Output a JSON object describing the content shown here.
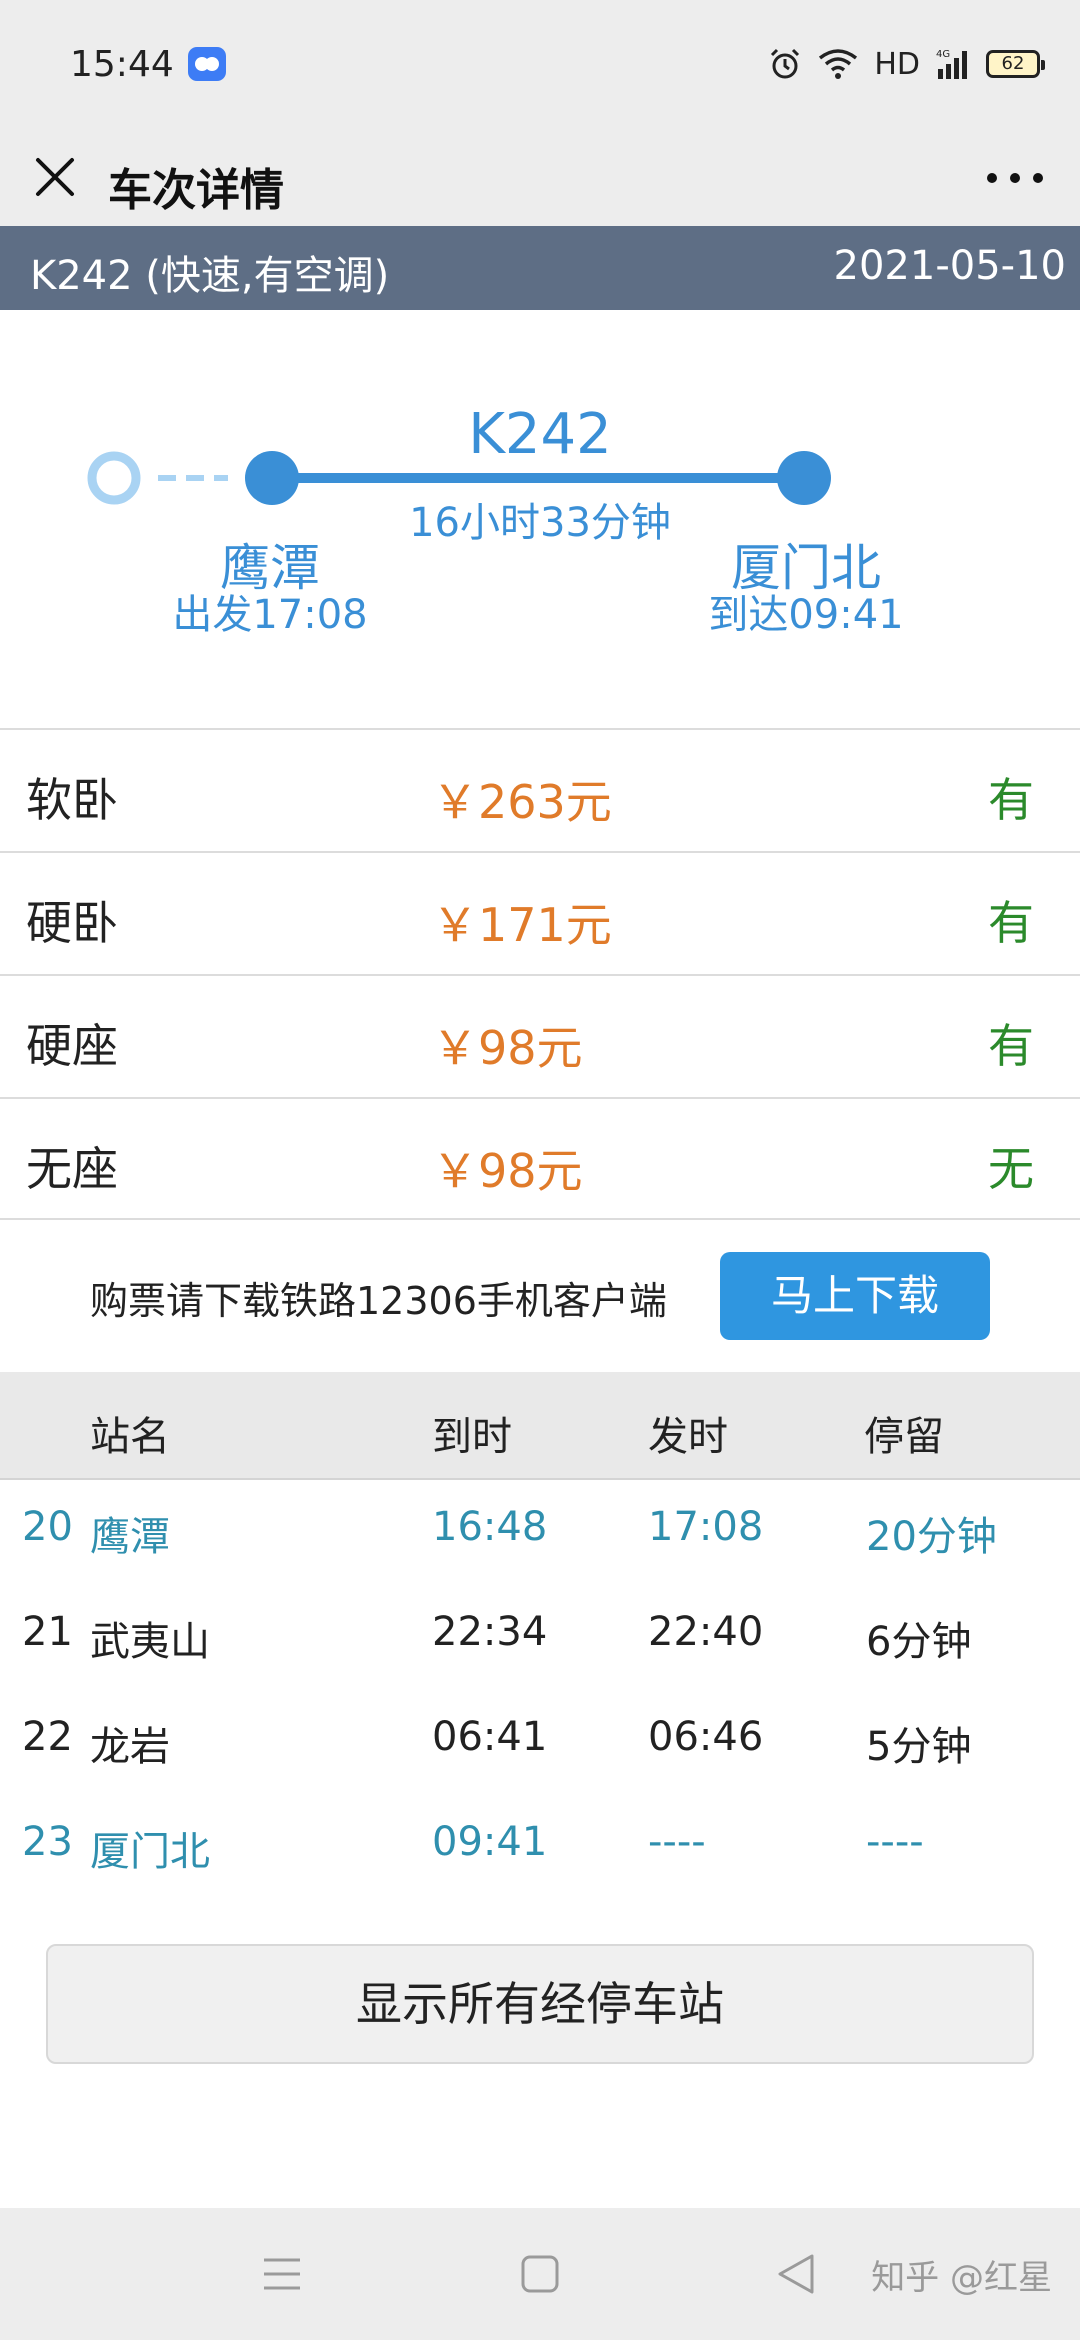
{
  "status_bar": {
    "time": "15:44",
    "network": "HD",
    "battery": "62",
    "icons": [
      "alarm-icon",
      "wifi-icon",
      "signal-icon",
      "battery-icon"
    ]
  },
  "nav": {
    "title": "车次详情",
    "close_icon": "close-icon",
    "more_icon": "more-icon"
  },
  "train": {
    "name": "K242 (快速,有空调)",
    "date": "2021-05-10",
    "code": "K242",
    "duration": "16小时33分钟",
    "from_station": "鹰潭",
    "from_time": "出发17:08",
    "to_station": "厦门北",
    "to_time": "到达09:41"
  },
  "prices": [
    {
      "seat": "软卧",
      "price": "￥263元",
      "availability": "有"
    },
    {
      "seat": "硬卧",
      "price": "￥171元",
      "availability": "有"
    },
    {
      "seat": "硬座",
      "price": "￥98元",
      "availability": "有"
    },
    {
      "seat": "无座",
      "price": "￥98元",
      "availability": "无"
    }
  ],
  "download": {
    "text": "购票请下载铁路12306手机客户端",
    "button": "马上下载"
  },
  "stops_header": {
    "station": "站名",
    "arrive": "到时",
    "depart": "发时",
    "stay": "停留"
  },
  "stops": [
    {
      "no": "20",
      "name": "鹰潭",
      "arrive": "16:48",
      "depart": "17:08",
      "stay": "20分钟"
    },
    {
      "no": "21",
      "name": "武夷山",
      "arrive": "22:34",
      "depart": "22:40",
      "stay": "6分钟"
    },
    {
      "no": "22",
      "name": "龙岩",
      "arrive": "06:41",
      "depart": "06:46",
      "stay": "5分钟"
    },
    {
      "no": "23",
      "name": "厦门北",
      "arrive": "09:41",
      "depart": "----",
      "stay": "----"
    }
  ],
  "show_all": "显示所有经停车站",
  "watermark": "知乎 @红星",
  "colors": {
    "accent": "#3a8fd6",
    "header_bg": "#5e6e85",
    "price": "#e07b2a",
    "available": "#2b8a2b",
    "highlight_stop": "#2f8fae"
  }
}
